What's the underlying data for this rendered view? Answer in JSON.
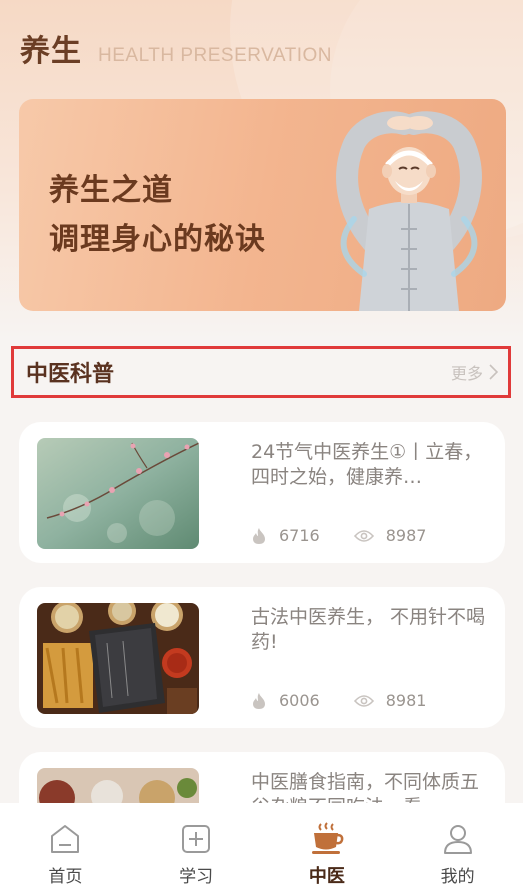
{
  "header": {
    "title": "养生",
    "subtitle": "HEALTH PRESERVATION"
  },
  "banner": {
    "line1": "养生之道",
    "line2": "调理身心的秘诀"
  },
  "section": {
    "title": "中医科普",
    "more_label": "更多"
  },
  "articles": [
    {
      "title": "24节气中医养生①丨立春，四时之始，健康养…",
      "likes": "6716",
      "views": "8987"
    },
    {
      "title": "古法中医养生，  不用针不喝药!",
      "likes": "6006",
      "views": "8981"
    },
    {
      "title": "中医膳食指南，不同体质五谷杂粮不同吃法，看",
      "likes": "",
      "views": ""
    }
  ],
  "tabs": [
    {
      "label": "首页",
      "icon": "home-icon"
    },
    {
      "label": "学习",
      "icon": "plus-square-icon"
    },
    {
      "label": "中医",
      "icon": "tea-cup-icon"
    },
    {
      "label": "我的",
      "icon": "user-icon"
    }
  ],
  "colors": {
    "accent": "#6b3e25",
    "highlight_border": "#e03a3a",
    "tab_active": "#c0703a"
  }
}
